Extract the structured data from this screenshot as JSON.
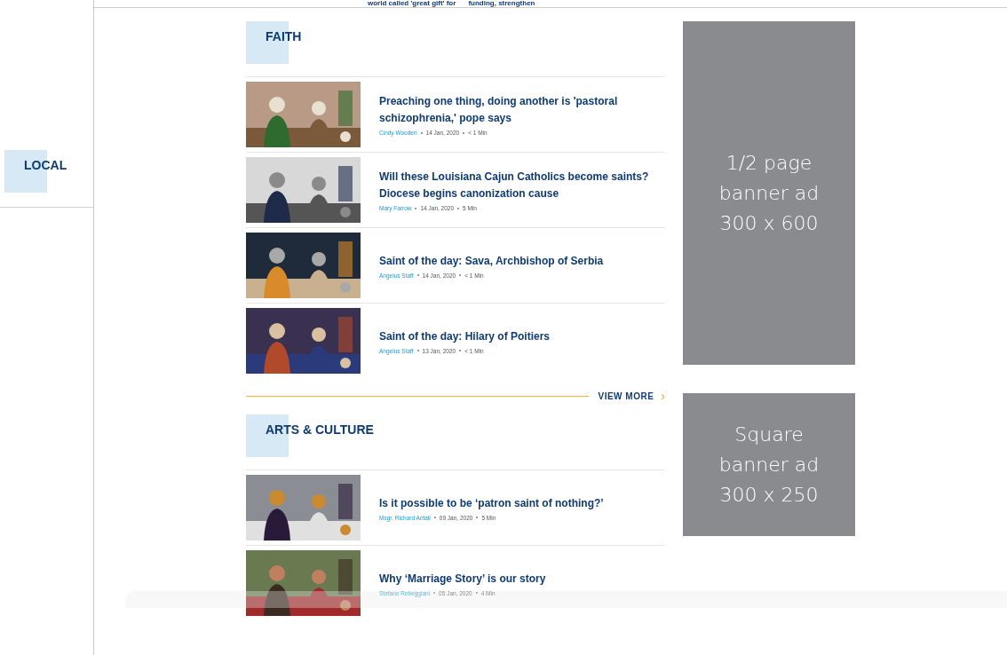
{
  "top_strip": {
    "texts": [
      "world called 'great gift' for",
      "funding, strengthen"
    ]
  },
  "sidebar": {
    "heading": "LOCAL"
  },
  "sections": [
    {
      "heading": "FAITH",
      "articles": [
        {
          "title": "Preaching one thing, doing another is 'pastoral schizophrenia,' pope says",
          "author": "Cindy Wooden",
          "date": "14 Jan, 2020",
          "read_time": "< 1 Min"
        },
        {
          "title": "Will these Louisiana Cajun Catholics become saints? Diocese begins canonization cause",
          "author": "Mary Farrow",
          "date": "14 Jan, 2020",
          "read_time": "5 Min"
        },
        {
          "title": "Saint of the day: Sava, Archbishop of Serbia",
          "author": "Angelus Staff",
          "date": "14 Jan, 2020",
          "read_time": "< 1 Min"
        },
        {
          "title": "Saint of the day: Hilary of Poitiers",
          "author": "Angelus Staff",
          "date": "13 Jan, 2020",
          "read_time": "< 1 Min"
        }
      ],
      "view_more": "VIEW MORE",
      "view_more_arrow": "›"
    },
    {
      "heading": "ARTS & CULTURE",
      "articles": [
        {
          "title": "Is it possible to be ‘patron saint of nothing?’",
          "author": "Msgr. Richard Antall",
          "date": "09 Jan, 2020",
          "read_time": "5 Min"
        },
        {
          "title": "Why ‘Marriage Story’ is our story",
          "author": "Stefano Rebeggiani",
          "date": "05 Jan, 2020",
          "read_time": "4 Min"
        }
      ]
    }
  ],
  "ads": [
    {
      "lines": [
        "1/2 page",
        "banner ad",
        "300 x 600"
      ],
      "kind": "tall"
    },
    {
      "lines": [
        "Square",
        "banner ad",
        "300 x 250"
      ],
      "kind": "square"
    }
  ]
}
